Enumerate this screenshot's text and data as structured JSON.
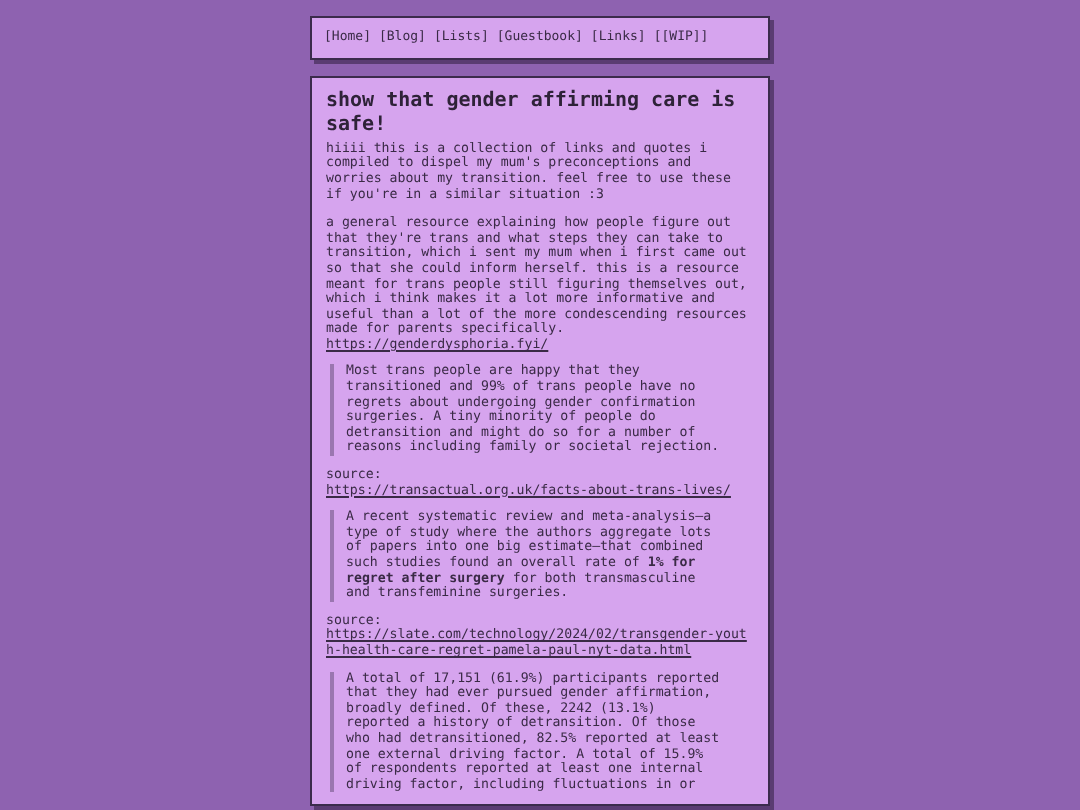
{
  "nav": [
    "[Home]",
    "[Blog]",
    "[Lists]",
    "[Guestbook]",
    "[Links]",
    "[[WIP]]"
  ],
  "title": "show that gender affirming care is safe!",
  "intro": "hiiii this is a collection of links and quotes i compiled to dispel my mum's preconceptions and worries about my transition. feel free to use these if you're in a similar situation :3",
  "blocks": [
    {
      "kind": "text",
      "text": "a general resource explaining how people figure out that they're trans and what steps they can take to transition, which i sent my mum when i first came out so that she could inform herself. this is a resource meant for trans people still figuring themselves out, which i think makes it a lot more informative and useful than a lot of the more condescending resources made for parents specifically.",
      "link": "https://genderdysphoria.fyi/"
    },
    {
      "kind": "quote",
      "text": "Most trans people are happy that they transitioned and 99% of trans people have no regrets about undergoing gender confirmation surgeries. A tiny minority of people do detransition and might do so for a number of reasons including family or societal rejection."
    },
    {
      "kind": "source",
      "text": "source:",
      "link": "https://transactual.org.uk/facts-about-trans-lives/"
    },
    {
      "kind": "quote",
      "text": "A recent systematic review and meta-analysis—a type of study where the authors aggregate lots of papers into one big estimate—that combined such studies found an overall rate of **1% for regret after surgery** for both transmasculine and transfeminine surgeries."
    },
    {
      "kind": "source",
      "text": "source:",
      "link": "https://slate.com/technology/2024/02/transgender-youth-health-care-regret-pamela-paul-nyt-data.html"
    },
    {
      "kind": "quote",
      "text": "A total of 17,151 (61.9%) participants reported that they had ever pursued gender affirmation, broadly defined. Of these, 2242 (13.1%) reported a history of detransition. Of those who had detransitioned, 82.5% reported at least one external driving factor. A total of 15.9% of respondents reported at least one internal driving factor, including fluctuations in or"
    }
  ]
}
